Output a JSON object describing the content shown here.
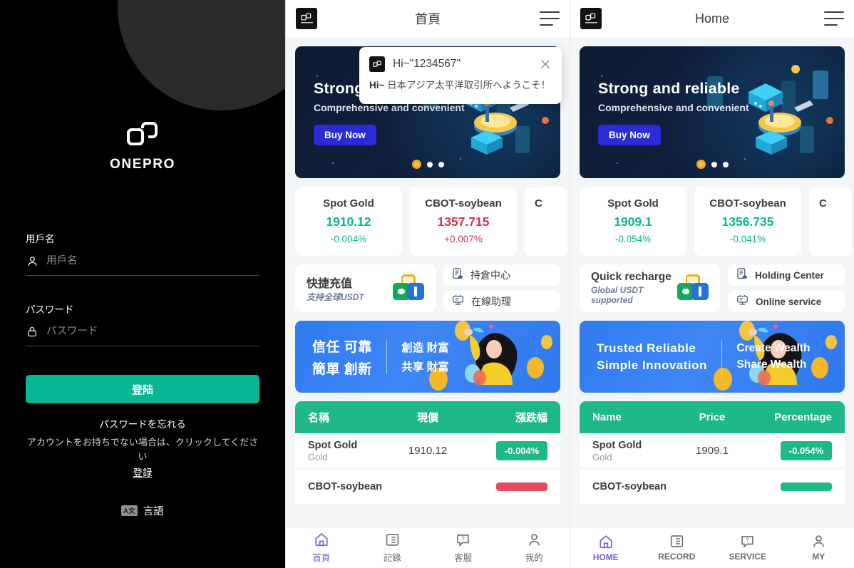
{
  "login": {
    "brand_name": "ONEPRO",
    "logo_icon": "onepro-logo-icon",
    "username_label": "用戶名",
    "username_placeholder": "用戶名",
    "username_value": "",
    "username_icon": "user-icon",
    "password_label": "パスワード",
    "password_placeholder": "パスワード",
    "password_value": "",
    "password_icon": "lock-icon",
    "login_button": "登陆",
    "forgot_password": "パスワードを忘れる",
    "no_account_text": "アカウントをお持ちでない場合は、クリックしてください",
    "register_link": "登録",
    "language_label": "言語",
    "language_icon_text": "A文",
    "accent_color": "#08b694",
    "background_color": "#000000",
    "decoration_circle_color": "#2b2b2b"
  },
  "phone_cn": {
    "header": {
      "title": "首頁",
      "logo_icon": "onepro-logo-icon",
      "menu_icon": "hamburger-menu-icon"
    },
    "toast": {
      "title": "Hi~\"1234567\"",
      "body_prefix": "Hi~",
      "body": " 日本アジア太平洋取引所へようこそ！",
      "close_icon": "close-icon",
      "logo_icon": "onepro-logo-icon"
    },
    "hero": {
      "heading": "Strong and reliable",
      "subheading": "Comprehensive and convenient",
      "cta": "Buy Now",
      "dots_total": 3,
      "dot_active_index": 0,
      "dot_active_color": "#f0a81e"
    },
    "quote_cards": [
      {
        "name": "Spot Gold",
        "price": "1910.12",
        "change": "-0.004%",
        "direction": "down"
      },
      {
        "name": "CBOT-soybean",
        "price": "1357.715",
        "change": "+0.007%",
        "direction": "up"
      },
      {
        "name": "C",
        "price": "",
        "change": "",
        "direction": "cut"
      }
    ],
    "recharge": {
      "title": "快捷充值",
      "subtitle": "支持全球USDT",
      "icon": "wallet-payment-icon"
    },
    "links": [
      {
        "label": "持倉中心",
        "icon": "holding-center-icon"
      },
      {
        "label": "在線助理",
        "icon": "online-service-icon"
      }
    ],
    "promo": {
      "left_line1": "信任 可靠",
      "left_line2": "簡單 創新",
      "right_line1": "創造 財富",
      "right_line2": "共享 財富"
    },
    "table": {
      "columns": [
        "名稱",
        "現價",
        "漲跌幅"
      ],
      "rows": [
        {
          "name": "Spot Gold",
          "sub": "Gold",
          "price": "1910.12",
          "change": "-0.004%",
          "direction": "down"
        },
        {
          "name": "CBOT-soybean",
          "sub": "",
          "price": "",
          "change": "",
          "direction": "up"
        }
      ]
    },
    "tabs": [
      {
        "label": "首頁",
        "icon": "home-icon",
        "active": true
      },
      {
        "label": "記錄",
        "icon": "record-list-icon",
        "active": false
      },
      {
        "label": "客服",
        "icon": "support-chat-icon",
        "active": false
      },
      {
        "label": "我的",
        "icon": "user-profile-icon",
        "active": false
      }
    ]
  },
  "phone_en": {
    "header": {
      "title": "Home",
      "logo_icon": "onepro-logo-icon",
      "menu_icon": "hamburger-menu-icon"
    },
    "hero": {
      "heading": "Strong and reliable",
      "subheading": "Comprehensive and convenient",
      "cta": "Buy Now",
      "dots_total": 3,
      "dot_active_index": 0,
      "dot_active_color": "#f0a81e"
    },
    "quote_cards": [
      {
        "name": "Spot Gold",
        "price": "1909.1",
        "change": "-0.054%",
        "direction": "down"
      },
      {
        "name": "CBOT-soybean",
        "price": "1356.735",
        "change": "-0.041%",
        "direction": "down"
      },
      {
        "name": "C",
        "price": "",
        "change": "",
        "direction": "cut"
      }
    ],
    "recharge": {
      "title": "Quick recharge",
      "subtitle": "Global USDT supported",
      "icon": "wallet-payment-icon"
    },
    "links": [
      {
        "label": "Holding Center",
        "icon": "holding-center-icon"
      },
      {
        "label": "Online service",
        "icon": "online-service-icon"
      }
    ],
    "promo": {
      "left_line1": "Trusted Reliable",
      "left_line2": "Simple Innovation",
      "right_line1": "Create  Wealth",
      "right_line2": "Share   Wealth"
    },
    "table": {
      "columns": [
        "Name",
        "Price",
        "Percentage"
      ],
      "rows": [
        {
          "name": "Spot Gold",
          "sub": "Gold",
          "price": "1909.1",
          "change": "-0.054%",
          "direction": "down"
        },
        {
          "name": "CBOT-soybean",
          "sub": "",
          "price": "",
          "change": "",
          "direction": "down"
        }
      ]
    },
    "tabs": [
      {
        "label": "HOME",
        "icon": "home-icon",
        "active": true
      },
      {
        "label": "RECORD",
        "icon": "record-list-icon",
        "active": false
      },
      {
        "label": "SERVICE",
        "icon": "support-chat-icon",
        "active": false
      },
      {
        "label": "MY",
        "icon": "user-profile-icon",
        "active": false
      }
    ]
  },
  "theme": {
    "green": "#1fb888",
    "red": "#e34b63",
    "blue": "#2b2bd8",
    "purple": "#7b5bdb"
  }
}
